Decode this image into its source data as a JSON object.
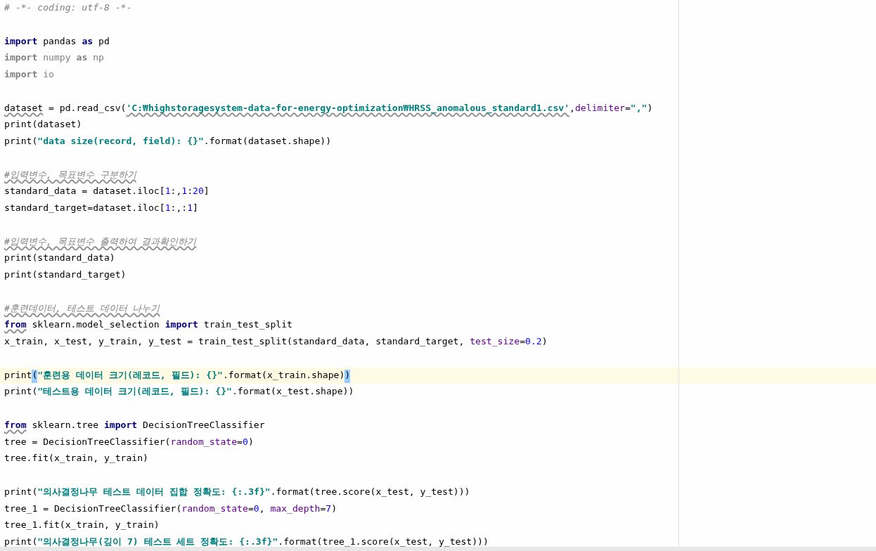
{
  "editor": {
    "lines": [
      {
        "current": false,
        "tokens": [
          {
            "text": "# -*- coding: utf-8 -*-",
            "kind": "comment",
            "squiggly": false
          }
        ]
      },
      {
        "current": false
      },
      {
        "current": false,
        "tokens": [
          {
            "text": "import",
            "kind": "keyword",
            "squiggly": false
          },
          {
            "text": " pandas ",
            "kind": "plain",
            "squiggly": false
          },
          {
            "text": "as",
            "kind": "keyword",
            "squiggly": false
          },
          {
            "text": " pd",
            "kind": "plain",
            "squiggly": false
          }
        ]
      },
      {
        "current": false,
        "tokens": [
          {
            "text": "import",
            "kind": "unused_keyword",
            "squiggly": false
          },
          {
            "text": " numpy ",
            "kind": "unused",
            "squiggly": false
          },
          {
            "text": "as",
            "kind": "unused_keyword",
            "squiggly": false
          },
          {
            "text": " np",
            "kind": "unused",
            "squiggly": false
          }
        ]
      },
      {
        "current": false,
        "tokens": [
          {
            "text": "import",
            "kind": "unused_keyword",
            "squiggly": false
          },
          {
            "text": " io",
            "kind": "unused",
            "squiggly": false
          }
        ]
      },
      {
        "current": false
      },
      {
        "current": false,
        "tokens": [
          {
            "text": "dataset",
            "kind": "plain",
            "squiggly": true
          },
          {
            "text": " = pd.read_csv(",
            "kind": "plain",
            "squiggly": false
          },
          {
            "text": "'C:₩highstoragesystem-data-for-energy-optimization₩HRSS_anomalous_standard1.csv'",
            "kind": "string",
            "squiggly": true
          },
          {
            "text": ",",
            "kind": "plain",
            "squiggly": false
          },
          {
            "text": "delimiter",
            "kind": "param",
            "squiggly": false
          },
          {
            "text": "=",
            "kind": "plain",
            "squiggly": false
          },
          {
            "text": "\",\"",
            "kind": "string",
            "squiggly": false
          },
          {
            "text": ")",
            "kind": "plain",
            "squiggly": false
          }
        ]
      },
      {
        "current": false,
        "tokens": [
          {
            "text": "print(dataset)",
            "kind": "plain",
            "squiggly": false
          }
        ]
      },
      {
        "current": false,
        "tokens": [
          {
            "text": "print(",
            "kind": "plain",
            "squiggly": false
          },
          {
            "text": "\"data size(record, field): {}\"",
            "kind": "string",
            "squiggly": false
          },
          {
            "text": ".format(dataset.shape))",
            "kind": "plain",
            "squiggly": false
          }
        ]
      },
      {
        "current": false
      },
      {
        "current": false,
        "tokens": [
          {
            "text": "#입력변수, 목표변수 구분하기",
            "kind": "comment",
            "squiggly": true
          }
        ]
      },
      {
        "current": false,
        "tokens": [
          {
            "text": "standard_data = dataset.iloc[",
            "kind": "plain",
            "squiggly": false
          },
          {
            "text": "1",
            "kind": "number",
            "squiggly": false
          },
          {
            "text": ":,",
            "kind": "plain",
            "squiggly": false
          },
          {
            "text": "1",
            "kind": "number",
            "squiggly": false
          },
          {
            "text": ":",
            "kind": "plain",
            "squiggly": false
          },
          {
            "text": "20",
            "kind": "number",
            "squiggly": false
          },
          {
            "text": "]",
            "kind": "plain",
            "squiggly": false
          }
        ]
      },
      {
        "current": false,
        "tokens": [
          {
            "text": "standard_target=dataset.iloc[",
            "kind": "plain",
            "squiggly": false
          },
          {
            "text": "1",
            "kind": "number",
            "squiggly": false
          },
          {
            "text": ":,:",
            "kind": "plain",
            "squiggly": false
          },
          {
            "text": "1",
            "kind": "number",
            "squiggly": false
          },
          {
            "text": "]",
            "kind": "plain",
            "squiggly": false
          }
        ]
      },
      {
        "current": false
      },
      {
        "current": false,
        "tokens": [
          {
            "text": "#입력변수, 목표변수 출력하여 결과확인하기",
            "kind": "comment",
            "squiggly": true
          }
        ]
      },
      {
        "current": false,
        "tokens": [
          {
            "text": "print(standard_data)",
            "kind": "plain",
            "squiggly": false
          }
        ]
      },
      {
        "current": false,
        "tokens": [
          {
            "text": "print(standard_target)",
            "kind": "plain",
            "squiggly": false
          }
        ]
      },
      {
        "current": false
      },
      {
        "current": false,
        "tokens": [
          {
            "text": "#훈련데이터, 테스트 데이터 나누기",
            "kind": "comment",
            "squiggly": true
          }
        ]
      },
      {
        "current": false,
        "tokens": [
          {
            "text": "from",
            "kind": "keyword",
            "squiggly": true
          },
          {
            "text": " sklearn.model_selection ",
            "kind": "plain",
            "squiggly": false
          },
          {
            "text": "import",
            "kind": "keyword",
            "squiggly": false
          },
          {
            "text": " train_test_split",
            "kind": "plain",
            "squiggly": false
          }
        ]
      },
      {
        "current": false,
        "tokens": [
          {
            "text": "x_train, x_test, y_train, y_test = train_test_split(standard_data, standard_target, ",
            "kind": "plain",
            "squiggly": false
          },
          {
            "text": "test_size",
            "kind": "param",
            "squiggly": false
          },
          {
            "text": "=",
            "kind": "plain",
            "squiggly": false
          },
          {
            "text": "0.2",
            "kind": "number",
            "squiggly": false
          },
          {
            "text": ")",
            "kind": "plain",
            "squiggly": false
          }
        ]
      },
      {
        "current": false
      },
      {
        "current": true,
        "tokens": [
          {
            "text": "print",
            "kind": "plain",
            "squiggly": false
          },
          {
            "text": "(",
            "kind": "brace_match",
            "squiggly": false
          },
          {
            "text": "\"훈련용 데이터 크기(레코드, 필드): {}\"",
            "kind": "string",
            "squiggly": false
          },
          {
            "text": ".format(x_train.shape)",
            "kind": "plain",
            "squiggly": false
          },
          {
            "text": ")",
            "kind": "brace_match",
            "squiggly": false
          }
        ]
      },
      {
        "current": false,
        "tokens": [
          {
            "text": "print(",
            "kind": "plain",
            "squiggly": false
          },
          {
            "text": "\"테스트용 데이터 크기(레코드, 필드): {}\"",
            "kind": "string",
            "squiggly": false
          },
          {
            "text": ".format(x_test.shape))",
            "kind": "plain",
            "squiggly": false
          }
        ]
      },
      {
        "current": false
      },
      {
        "current": false,
        "tokens": [
          {
            "text": "from",
            "kind": "keyword",
            "squiggly": true
          },
          {
            "text": " sklearn.tree ",
            "kind": "plain",
            "squiggly": false
          },
          {
            "text": "import",
            "kind": "keyword",
            "squiggly": false
          },
          {
            "text": " DecisionTreeClassifier",
            "kind": "plain",
            "squiggly": false
          }
        ]
      },
      {
        "current": false,
        "tokens": [
          {
            "text": "tree = DecisionTreeClassifier(",
            "kind": "plain",
            "squiggly": false
          },
          {
            "text": "random_state",
            "kind": "param",
            "squiggly": false
          },
          {
            "text": "=",
            "kind": "plain",
            "squiggly": false
          },
          {
            "text": "0",
            "kind": "number",
            "squiggly": false
          },
          {
            "text": ")",
            "kind": "plain",
            "squiggly": false
          }
        ]
      },
      {
        "current": false,
        "tokens": [
          {
            "text": "tree.fit(x_train, y_train)",
            "kind": "plain",
            "squiggly": false
          }
        ]
      },
      {
        "current": false
      },
      {
        "current": false,
        "tokens": [
          {
            "text": "print(",
            "kind": "plain",
            "squiggly": false
          },
          {
            "text": "\"의사결정나무 테스트 데이터 집합 정확도: {:.3f}\"",
            "kind": "string",
            "squiggly": false
          },
          {
            "text": ".format(tree.score(x_test, y_test)))",
            "kind": "plain",
            "squiggly": false
          }
        ]
      },
      {
        "current": false,
        "tokens": [
          {
            "text": "tree_1 = DecisionTreeClassifier(",
            "kind": "plain",
            "squiggly": false
          },
          {
            "text": "random_state",
            "kind": "param",
            "squiggly": false
          },
          {
            "text": "=",
            "kind": "plain",
            "squiggly": false
          },
          {
            "text": "0",
            "kind": "number",
            "squiggly": false
          },
          {
            "text": ", ",
            "kind": "plain",
            "squiggly": false
          },
          {
            "text": "max_depth",
            "kind": "param",
            "squiggly": false
          },
          {
            "text": "=",
            "kind": "plain",
            "squiggly": false
          },
          {
            "text": "7",
            "kind": "number",
            "squiggly": false
          },
          {
            "text": ")",
            "kind": "plain",
            "squiggly": false
          }
        ]
      },
      {
        "current": false,
        "tokens": [
          {
            "text": "tree_1.fit(x_train, y_train)",
            "kind": "plain",
            "squiggly": false
          }
        ]
      },
      {
        "current": false,
        "tokens": [
          {
            "text": "print(",
            "kind": "plain",
            "squiggly": false
          },
          {
            "text": "\"의사결정나무(깊이 7) 테스트 세트 정확도: {:.3f}\"",
            "kind": "string",
            "squiggly": false
          },
          {
            "text": ".format(tree_1.score(x_test, y_test)))",
            "kind": "plain",
            "squiggly": false
          }
        ]
      }
    ]
  }
}
